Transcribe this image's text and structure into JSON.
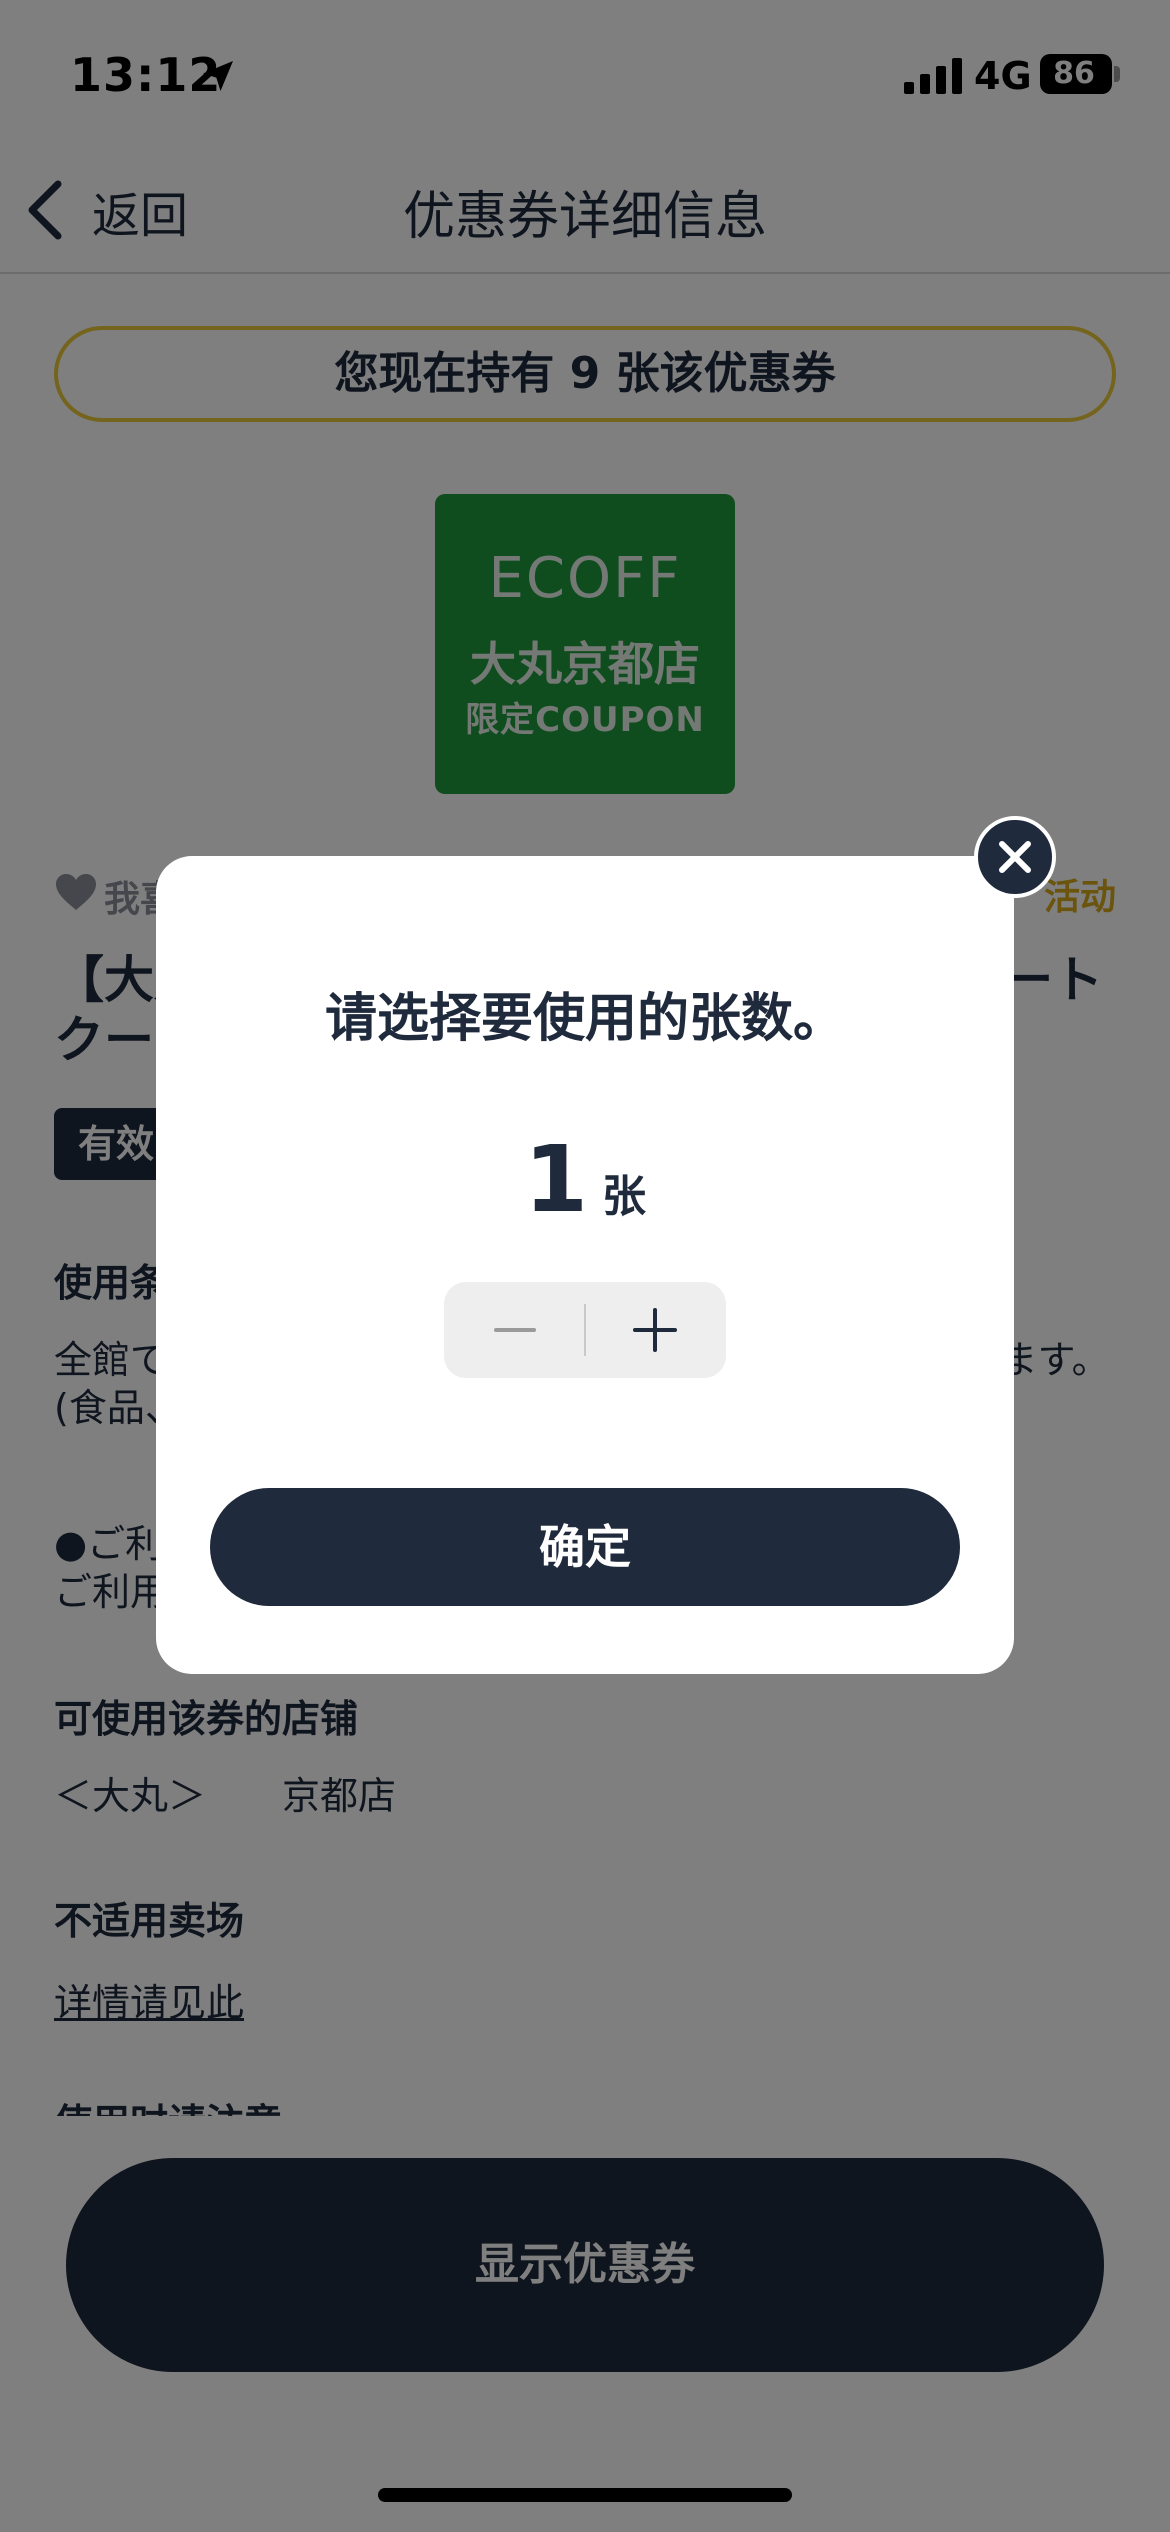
{
  "status_bar": {
    "time": "13:12",
    "network": "4G",
    "battery": "86"
  },
  "nav": {
    "back_label": "返回",
    "title": "优惠券详细信息"
  },
  "holding_banner": "您现在持有 9 张该优惠券",
  "coupon_logo": {
    "brand": "ECOFF",
    "store": "大丸京都店",
    "sub": "限定COUPON"
  },
  "favorite": {
    "label": "我喜"
  },
  "event_tag": "活动",
  "coupon_title": "【大丸京都店限定】ECOFF クーポン　ポートクーポン",
  "validity_badge": "有效",
  "sections": {
    "conditions_label": "使用条件",
    "conditions_text": "全館でお買い物にご利用いただけます。ご利用いただけます。\n(食品、一部ブランド・売場を除外)",
    "notice_text": "●ご利用\nご利用",
    "stores_label": "可使用该券的店铺",
    "stores_text": "＜大丸＞　　京都店",
    "excluded_label": "不适用卖场",
    "excluded_link": "详情请见此",
    "caution_label": "使用时请注意"
  },
  "show_coupon_button": "显示优惠券",
  "modal": {
    "title": "请选择要使用的张数。",
    "quantity": "1",
    "unit": "张",
    "confirm_label": "确定"
  },
  "colors": {
    "navy": "#1f2a3c",
    "accent_yellow": "#e8c93b",
    "logo_green": "#1f9a3f"
  },
  "icons": [
    "location-arrow-icon",
    "signal-icon",
    "battery-icon",
    "back-chevron-icon",
    "heart-icon",
    "minus-icon",
    "plus-icon",
    "close-icon"
  ]
}
